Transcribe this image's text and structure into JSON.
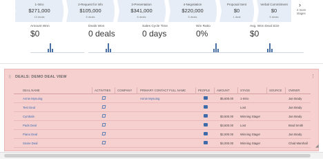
{
  "pipeline": {
    "stages": [
      {
        "name": "1-Intro",
        "amount": "$271,000",
        "count": "13 deals"
      },
      {
        "name": "2-Request for info",
        "amount": "$105,000",
        "count": "6 deals"
      },
      {
        "name": "3-Presentation",
        "amount": "$341,000",
        "count": "8 deals"
      },
      {
        "name": "4-Negotiation",
        "amount": "$220,000",
        "count": "5 deals"
      },
      {
        "name": "Proposal Sent",
        "amount": "$0",
        "count": "1 deal"
      },
      {
        "name": "Verbal Commitment",
        "amount": "$0",
        "count": "5 deals"
      }
    ],
    "more_line1": "2 more",
    "more_line2": "stages",
    "stage_color": "#e7edf6"
  },
  "kpis": [
    {
      "label": "Amount Won",
      "value": "$0",
      "bars": [
        0,
        0,
        0,
        0.3,
        0.8,
        0.3,
        0
      ]
    },
    {
      "label": "Deals Won",
      "value": "0 deals",
      "bars": [
        0,
        0,
        0,
        0.3,
        0.8,
        0.3,
        0
      ]
    },
    {
      "label": "Sales Cycle Time",
      "value": "0 days",
      "bars": [
        0,
        0,
        0,
        0,
        0,
        0,
        0
      ]
    },
    {
      "label": "Win Ratio",
      "value": "0%",
      "bars": [
        0,
        0,
        0,
        0.3,
        0.8,
        0.3,
        0
      ]
    },
    {
      "label": "Avg. Won Deal Size",
      "value": "$0",
      "bars": [
        0,
        0,
        0,
        0.3,
        0.8,
        0.3,
        0
      ]
    }
  ],
  "panel": {
    "title": "DEALS: DEMO DEAL VIEW",
    "bg_color": "#f6cfcf",
    "columns": [
      "DEAL NAME",
      "ACTIVITIES",
      "COMPANY",
      "PRIMARY CONTACT FULL NAME",
      "PEOPLE",
      "AMOUNT",
      "STAGE",
      "SOURCE",
      "OWNER"
    ],
    "rows": [
      {
        "deal": "Annie Mynuing",
        "contact": "Annie Mynuing",
        "amount": "$5,600.00",
        "stage": "1-Intro",
        "source": "",
        "owner": "Jan Brady"
      },
      {
        "deal": "Test Deal",
        "contact": "",
        "amount": "",
        "stage": "Lost",
        "source": "",
        "owner": "Jan Brady"
      },
      {
        "deal": "Cymbals",
        "contact": "",
        "amount": "$3,500.00",
        "stage": "Winning Stage!",
        "source": "",
        "owner": "Jan Brady"
      },
      {
        "deal": "Pads Deal",
        "contact": "",
        "amount": "$3,500.00",
        "stage": "Lost",
        "source": "",
        "owner": "Brad Smith"
      },
      {
        "deal": "Piano Deal",
        "contact": "",
        "amount": "$2,000.00",
        "stage": "Winning Stage!",
        "source": "",
        "owner": "Jan Brady"
      },
      {
        "deal": "Snare Deal",
        "contact": "",
        "amount": "$4,000.00",
        "stage": "Winning Stage!",
        "source": "",
        "owner": "Chad Marshall"
      }
    ]
  }
}
